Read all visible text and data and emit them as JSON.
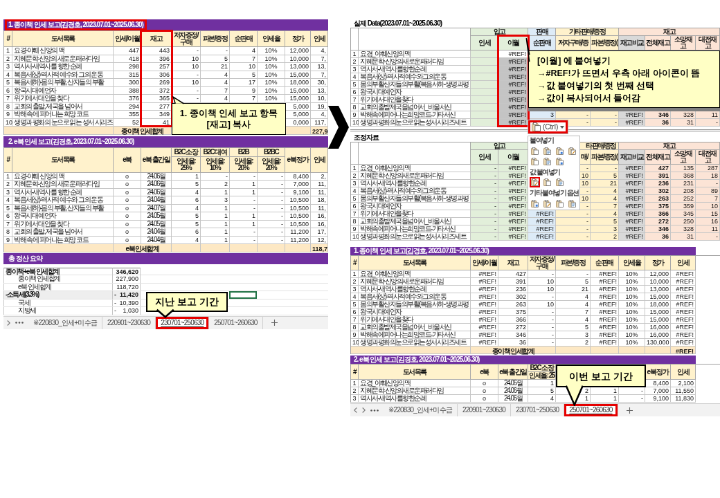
{
  "left_sheet": {
    "paper_report": {
      "title": "1. 종이책 인세 보고(김경호, 2023.07.01~2025.06.30)",
      "title_highlighted": true,
      "columns": {
        "no": {
          "label": "#",
          "highlighted": false
        },
        "title": {
          "label": "도서목록",
          "highlighted": false
        },
        "carryover": {
          "label": "인세/이월",
          "highlighted": false
        },
        "stock": {
          "label": "재고",
          "highlighted": true
        },
        "author_copies": {
          "label": "저자증정/구매",
          "highlighted": false
        },
        "damaged": {
          "label": "파본/증정",
          "highlighted": false
        },
        "net_sales": {
          "label": "순판매",
          "highlighted": false
        },
        "rate": {
          "label": "인세율",
          "highlighted": false
        },
        "price": {
          "label": "정가",
          "highlighted": false
        },
        "royalty": {
          "label": "인세",
          "highlighted": false
        }
      },
      "rows": [
        {
          "no": "1",
          "title": "요경-야훼 신앙의 맥",
          "carryover": "447",
          "stock": "443",
          "author_copies": "-",
          "damaged": "-",
          "net_sales": "4",
          "rate": "10%",
          "price": "12,000",
          "royalty": "4,"
        },
        {
          "no": "2",
          "title": "지혜문학-신앙의 새로운 패러다임",
          "carryover": "418",
          "stock": "396",
          "author_copies": "10",
          "damaged": "5",
          "net_sales": "7",
          "rate": "10%",
          "price": "10,000",
          "royalty": "7,"
        },
        {
          "no": "3",
          "title": "역사서-새역사를 향한 순례",
          "carryover": "298",
          "stock": "257",
          "author_copies": "10",
          "damaged": "21",
          "net_sales": "10",
          "rate": "10%",
          "price": "13,000",
          "royalty": "13,"
        },
        {
          "no": "4",
          "title": "복음서(상)-역사적 예수와 그의 운동",
          "carryover": "315",
          "stock": "306",
          "author_copies": "-",
          "damaged": "4",
          "net_sales": "5",
          "rate": "10%",
          "price": "15,000",
          "royalty": "7,"
        },
        {
          "no": "5",
          "title": "복음서(하)-몸의 부활, 산자들의 부활",
          "carryover": "300",
          "stock": "269",
          "author_copies": "10",
          "damaged": "4",
          "net_sales": "17",
          "rate": "10%",
          "price": "18,000",
          "royalty": "30,"
        },
        {
          "no": "6",
          "title": "왕국시대 예언자",
          "carryover": "388",
          "stock": "372",
          "author_copies": "-",
          "damaged": "7",
          "net_sales": "9",
          "rate": "10%",
          "price": "15,000",
          "royalty": "13,"
        },
        {
          "no": "7",
          "title": "위기에서 대안을 찾다",
          "carryover": "376",
          "stock": "365",
          "author_copies": "-",
          "damaged": "4",
          "net_sales": "7",
          "rate": "10%",
          "price": "15,000",
          "royalty": "10,"
        },
        {
          "no": "8",
          "title": "교회의 출발, 제국을 넘어서",
          "carryover": "294",
          "stock": "277",
          "price": "5,000",
          "royalty": "19,"
        },
        {
          "no": "9",
          "title": "박해 속에 피어나는 희망 코드",
          "carryover": "355",
          "stock": "349",
          "price": "5,000",
          "royalty": "4,"
        },
        {
          "no": "10",
          "title": "생명과 평화의 눈으로 읽는 성서 시리즈",
          "carryover": "52",
          "stock": "41",
          "price": "0,000",
          "royalty": "117,"
        }
      ],
      "total": {
        "label": "종이책 인세합계",
        "value": "227,9"
      },
      "callout": {
        "lines": [
          "1. 종이책 인세 보고 항목",
          "[재고] 복사"
        ]
      }
    },
    "ebook_report": {
      "title": "2. e북 인세 보고(김경호, 2023.07.01~2025.06.30)",
      "columns": {
        "no": {
          "label": "#"
        },
        "title": {
          "label": "도서목록"
        },
        "ebook": {
          "label": "e북"
        },
        "release": {
          "label": "e북 출간일"
        },
        "b2c_own": {
          "label": "B2C 소장",
          "sublabel": "인세율: 25%"
        },
        "b2c_rent": {
          "label": "B2C 대여",
          "sublabel": "인세율: 10%"
        },
        "b2b": {
          "label": "B2B",
          "sublabel": "인세율: 20%"
        },
        "b2bc": {
          "label": "B2BC",
          "sublabel": "인세율: 20%"
        },
        "ebook_price": {
          "label": "e북 정가"
        },
        "royalty": {
          "label": "인세"
        }
      },
      "rows": [
        {
          "no": "1",
          "title": "요경-야훼 신앙의 맥",
          "ebook": "o",
          "release": "24.06월",
          "b2c_own": "1",
          "b2c_rent": "-",
          "b2b": "-",
          "b2bc": "-",
          "ebook_price": "8,400",
          "royalty": "2,"
        },
        {
          "no": "2",
          "title": "지혜문학-신앙의 새로운 패러다임",
          "ebook": "o",
          "release": "24.06월",
          "b2c_own": "5",
          "b2c_rent": "2",
          "b2b": "1",
          "b2bc": "-",
          "ebook_price": "7,000",
          "royalty": "11,"
        },
        {
          "no": "3",
          "title": "역사서-새역사를 향한 순례",
          "ebook": "o",
          "release": "24.06월",
          "b2c_own": "4",
          "b2c_rent": "1",
          "b2b": "1",
          "b2bc": "-",
          "ebook_price": "9,100",
          "royalty": "11,"
        },
        {
          "no": "4",
          "title": "복음서(상)-역사적 예수와 그의 운동",
          "ebook": "o",
          "release": "24.04월",
          "b2c_own": "6",
          "b2c_rent": "3",
          "b2b": "-",
          "b2bc": "-",
          "ebook_price": "10,500",
          "royalty": "18,"
        },
        {
          "no": "5",
          "title": "복음서(하)-몸의 부활, 산자들의 부활",
          "ebook": "o",
          "release": "24.07월",
          "b2c_own": "4",
          "b2c_rent": "1",
          "b2b": "-",
          "b2bc": "-",
          "ebook_price": "10,500",
          "royalty": "11,"
        },
        {
          "no": "6",
          "title": "왕국시대 예언자",
          "ebook": "o",
          "release": "24.05월",
          "b2c_own": "5",
          "b2c_rent": "1",
          "b2b": "1",
          "b2bc": "-",
          "ebook_price": "10,500",
          "royalty": "16,"
        },
        {
          "no": "7",
          "title": "위기에서 대안을 찾다",
          "ebook": "o",
          "release": "24.05월",
          "b2c_own": "5",
          "b2c_rent": "1",
          "b2b": "1",
          "b2bc": "-",
          "ebook_price": "10,500",
          "royalty": "16,"
        },
        {
          "no": "8",
          "title": "교회의 출발, 제국을 넘어서",
          "ebook": "o",
          "release": "24.04월",
          "b2c_own": "6",
          "b2c_rent": "1",
          "b2b": "-",
          "b2bc": "-",
          "ebook_price": "11,200",
          "royalty": "17,"
        },
        {
          "no": "9",
          "title": "박해 속에 피어나는 희망 코드",
          "ebook": "o",
          "release": "24.04월",
          "b2c_own": "4",
          "b2c_rent": "1",
          "b2b": "-",
          "b2bc": "-",
          "ebook_price": "11,200",
          "royalty": "12,"
        }
      ],
      "total": {
        "label": "e북 인세합계",
        "value": "118,7"
      }
    },
    "summary": {
      "title": "총 정산 요약",
      "rows": [
        {
          "kind": "sum",
          "label": "종이책+e북 인세합계",
          "value": "346,620",
          "active_cell": false
        },
        {
          "kind": "item",
          "label": "종이책 인세합계",
          "value": "227,900",
          "active_cell": false
        },
        {
          "kind": "item",
          "label": "e북 인세합계",
          "value": "118,720",
          "active_cell": false
        },
        {
          "kind": "deduction",
          "label": "-소득세(3.3%)",
          "sign": "-",
          "value": "11,420",
          "active_cell": true
        },
        {
          "kind": "item",
          "label": "국세",
          "sign": "-",
          "value": "10,390",
          "active_cell": false
        },
        {
          "kind": "item",
          "label": "지방세",
          "sign": "-",
          "value": "1,030",
          "active_cell": false
        }
      ]
    },
    "sheet_tabs": [
      {
        "label": "※220830_인세+미수금",
        "selected": false,
        "highlighted": false
      },
      {
        "label": "220901~230630",
        "selected": false,
        "highlighted": false
      },
      {
        "label": "230701~250630",
        "selected": true,
        "highlighted": true
      },
      {
        "label": "250701~260630",
        "selected": false,
        "highlighted": false
      }
    ],
    "tab_callout": {
      "lines": [
        "지난 보고 기간"
      ]
    }
  },
  "right_sheet": {
    "actual_data": {
      "title": "실제 Data(2023.07.01~2025.06.30)",
      "groups": {
        "inbound": {
          "label": "입고",
          "color": "#e2efda"
        },
        "sales": {
          "label": "판매",
          "color": "#ddebf7"
        },
        "other": {
          "label": "기타판매/증정",
          "color": "#fff2cc"
        },
        "stock": {
          "label": "재고",
          "color": "#fce4d6"
        }
      },
      "columns": {
        "royalty": {
          "label": "인세",
          "color": "#e2efda",
          "highlighted": false,
          "selected": false
        },
        "carryover": {
          "label": "이월",
          "color": "#e2efda",
          "highlighted": true,
          "selected": true
        },
        "net_sales": {
          "label": "순판매",
          "color": "#ddebf7",
          "highlighted": false,
          "selected": false
        },
        "author": {
          "label": "저자구매/증",
          "color": "#fff2cc",
          "highlighted": false,
          "selected": false
        },
        "damaged": {
          "label": "파본/증정(",
          "color": "#fff2cc",
          "highlighted": false,
          "selected": false
        },
        "compare": {
          "label": "재고비교",
          "color": "#d9d9d9",
          "highlighted": false,
          "selected": false
        },
        "total_stock": {
          "label": "전체재고",
          "color": "#fce4d6",
          "highlighted": false,
          "selected": false
        },
        "somang": {
          "label": "소망재고",
          "color": "#fce4d6",
          "highlighted": false,
          "selected": false
        },
        "daejeon": {
          "label": "대전재고",
          "color": "#fce4d6",
          "highlighted": false,
          "selected": false
        }
      },
      "rows": [
        {
          "no": "1",
          "title": "요경_야훼신앙의맥",
          "carryover": "#REF!"
        },
        {
          "no": "2",
          "title": "지혜문학-신앙의새로운패러다임",
          "carryover": "#REF!"
        },
        {
          "no": "3",
          "title": "역사서-새역사를향한순례",
          "carryover": "#REF!"
        },
        {
          "no": "4",
          "title": "복음서(상)-역사적예수와그의운동",
          "carryover": "#REF!"
        },
        {
          "no": "5",
          "title": "몸의부활산자들의부활(복음서하-생명과평",
          "carryover": "#REF!"
        },
        {
          "no": "6",
          "title": "왕국시대예언자",
          "carryover": "#REF!"
        },
        {
          "no": "7",
          "title": "위기에서대안을찾다",
          "carryover": "#REF!"
        },
        {
          "no": "8",
          "title": "교회의출발제국을넘어서_바울서신",
          "carryover": "#REF!"
        },
        {
          "no": "9",
          "title": "박해속에피어나는희망코드-기타서신",
          "carryover": "#REF!",
          "net_sales": "3",
          "author": "-",
          "damaged": "-",
          "compare": "#REF!",
          "total_stock": "346",
          "somang": "328",
          "daejeon": "11"
        },
        {
          "no": "10",
          "title": "생명과평화의눈으로읽는성서시리즈세트",
          "carryover": "#REF!",
          "author": "-",
          "damaged": "-",
          "compare": "#REF!",
          "total_stock": "36",
          "somang": "31",
          "daejeon": "-"
        }
      ],
      "callout": {
        "lines": [
          "[이월] 에 붙여넣기",
          "→#REF!가 뜨면서 우측 아래 아이콘이 뜸",
          "→값 붙여넣기의 첫 번째 선택",
          "→값이 복사되어서 들어감"
        ]
      }
    },
    "paste_button": {
      "label": "(Ctrl)",
      "highlighted": true
    },
    "paste_menu": {
      "sections": [
        {
          "title": "붙여넣기",
          "options": [
            {
              "highlighted": false
            },
            {
              "highlighted": false
            },
            {
              "highlighted": false
            },
            {
              "highlighted": false
            },
            {
              "highlighted": false
            },
            {
              "highlighted": false
            },
            {
              "highlighted": false
            }
          ]
        },
        {
          "title": "값 붙여넣기",
          "options": [
            {
              "highlighted": true
            },
            {
              "highlighted": false
            },
            {
              "highlighted": false
            }
          ]
        },
        {
          "title": "기타 붙여넣기 옵션",
          "options": [
            {
              "highlighted": false
            },
            {
              "highlighted": false
            },
            {
              "highlighted": false
            },
            {
              "highlighted": false
            }
          ]
        }
      ]
    },
    "adjustment": {
      "title": "조정자료",
      "groups": {
        "inbound": {
          "label": "입고",
          "color": "#e2efda"
        },
        "other": {
          "label": "타판매/증정",
          "color": "#fff2cc"
        },
        "stock": {
          "label": "재고",
          "color": "#fce4d6"
        }
      },
      "columns": {
        "royalty": {
          "label": "인세",
          "color": "#e2efda"
        },
        "carryover": {
          "label": "이월",
          "color": "#e2efda"
        },
        "net_sales": {
          "color": "#ddebf7"
        },
        "author": {
          "label": "매/",
          "color": "#fff2cc"
        },
        "damaged": {
          "label": "파본/증정(",
          "color": "#fff2cc"
        },
        "compare": {
          "label": "재고비교",
          "color": "#d9d9d9"
        },
        "total_stock": {
          "label": "전체재고",
          "color": "#fce4d6"
        },
        "somang": {
          "label": "소망재고",
          "color": "#fce4d6"
        },
        "daejeon": {
          "label": "대전재고",
          "color": "#fce4d6"
        }
      },
      "rows": [
        {
          "no": "1",
          "title": "요경_야훼신앙의맥",
          "royalty": "-",
          "carryover": "#REF!",
          "author": "-",
          "damaged": "-",
          "compare": "#REF!",
          "total_stock": "427",
          "somang": "135",
          "daejeon": "287"
        },
        {
          "no": "2",
          "title": "지혜문학-신앙의새로운패러다임",
          "royalty": "-",
          "carryover": "#REF!",
          "author": "10",
          "damaged": "5",
          "compare": "#REF!",
          "total_stock": "391",
          "somang": "368",
          "daejeon": "18"
        },
        {
          "no": "3",
          "title": "역사서-새역사를향한순례",
          "royalty": "-",
          "carryover": "#REF!",
          "author": "10",
          "damaged": "21",
          "compare": "#REF!",
          "total_stock": "236",
          "somang": "231",
          "daejeon": "-"
        },
        {
          "no": "4",
          "title": "복음서(상)-역사적예수와그의운동",
          "royalty": "-",
          "carryover": "#REF!",
          "author": "-",
          "damaged": "4",
          "compare": "#REF!",
          "total_stock": "302",
          "somang": "208",
          "daejeon": "89"
        },
        {
          "no": "5",
          "title": "몸의부활산자들의부활(복음서하-생명과평",
          "royalty": "-",
          "carryover": "#REF!",
          "author": "10",
          "damaged": "4",
          "compare": "#REF!",
          "total_stock": "263",
          "somang": "252",
          "daejeon": "7"
        },
        {
          "no": "6",
          "title": "왕국시대예언자",
          "royalty": "-",
          "carryover": "#REF!",
          "author": "-",
          "damaged": "7",
          "compare": "#REF!",
          "total_stock": "375",
          "somang": "359",
          "daejeon": "10"
        },
        {
          "no": "7",
          "title": "위기에서대안을찾다",
          "royalty": "-",
          "carryover": "#REF!",
          "net_sales": "#REF!",
          "author": "-",
          "damaged": "4",
          "compare": "#REF!",
          "total_stock": "366",
          "somang": "345",
          "daejeon": "15"
        },
        {
          "no": "8",
          "title": "교회의출발제국을넘어서_바울서신",
          "royalty": "-",
          "carryover": "#REF!",
          "net_sales": "#REF!",
          "author": "-",
          "damaged": "5",
          "compare": "#REF!",
          "total_stock": "272",
          "somang": "250",
          "daejeon": "16"
        },
        {
          "no": "9",
          "title": "박해속에피어나는희망코드-기타서신",
          "royalty": "-",
          "carryover": "#REF!",
          "net_sales": "#REF!",
          "author": "-",
          "damaged": "3",
          "compare": "#REF!",
          "total_stock": "346",
          "somang": "328",
          "daejeon": "11"
        },
        {
          "no": "10",
          "title": "생명과평화의눈으로읽는성서시리즈세트",
          "royalty": "-",
          "carryover": "#REF!",
          "net_sales": "#REF!",
          "author": "-",
          "damaged": "2",
          "compare": "#REF!",
          "total_stock": "36",
          "somang": "31",
          "daejeon": "-"
        }
      ]
    },
    "paper_report": {
      "title": "1. 종이책 인세 보고(김경호, 2023.07.01~2025.06.30)",
      "columns": {
        "no": {
          "label": "#"
        },
        "title": {
          "label": "도서목록"
        },
        "carryover": {
          "label": "인세/이월"
        },
        "stock": {
          "label": "재고"
        },
        "author_copies": {
          "label": "저자증정/구매"
        },
        "damaged": {
          "label": "파본/증정"
        },
        "net_sales": {
          "label": "순판매"
        },
        "rate": {
          "label": "인세율"
        },
        "price": {
          "label": "정가"
        },
        "royalty": {
          "label": "인세"
        }
      },
      "rows": [
        {
          "no": "1",
          "title": "요경_야훼신앙의맥",
          "carryover": "#REF!",
          "stock": "427",
          "author_copies": "-",
          "damaged": "-",
          "net_sales": "#REF!",
          "rate": "10%",
          "price": "12,000",
          "royalty": "#REF!"
        },
        {
          "no": "2",
          "title": "지혜문학-신앙의새로운패러다임",
          "carryover": "#REF!",
          "stock": "391",
          "author_copies": "10",
          "damaged": "5",
          "net_sales": "#REF!",
          "rate": "10%",
          "price": "10,000",
          "royalty": "#REF!"
        },
        {
          "no": "3",
          "title": "역사서-새역사를향한순례",
          "carryover": "#REF!",
          "stock": "236",
          "author_copies": "10",
          "damaged": "21",
          "net_sales": "#REF!",
          "rate": "10%",
          "price": "13,000",
          "royalty": "#REF!"
        },
        {
          "no": "4",
          "title": "복음서(상)-역사적예수와그의운동",
          "carryover": "#REF!",
          "stock": "302",
          "author_copies": "-",
          "damaged": "4",
          "net_sales": "#REF!",
          "rate": "10%",
          "price": "15,000",
          "royalty": "#REF!"
        },
        {
          "no": "5",
          "title": "몸의부활산자들의부활(복음서하-생명과평",
          "carryover": "#REF!",
          "stock": "263",
          "author_copies": "10",
          "damaged": "4",
          "net_sales": "#REF!",
          "rate": "10%",
          "price": "18,000",
          "royalty": "#REF!"
        },
        {
          "no": "6",
          "title": "왕국시대예언자",
          "carryover": "#REF!",
          "stock": "375",
          "author_copies": "-",
          "damaged": "7",
          "net_sales": "#REF!",
          "rate": "10%",
          "price": "15,000",
          "royalty": "#REF!"
        },
        {
          "no": "7",
          "title": "위기에서대안을찾다",
          "carryover": "#REF!",
          "stock": "366",
          "author_copies": "-",
          "damaged": "4",
          "net_sales": "#REF!",
          "rate": "10%",
          "price": "15,000",
          "royalty": "#REF!"
        },
        {
          "no": "8",
          "title": "교회의출발제국을넘어서_바울서신",
          "carryover": "#REF!",
          "stock": "272",
          "author_copies": "-",
          "damaged": "5",
          "net_sales": "#REF!",
          "rate": "10%",
          "price": "16,000",
          "royalty": "#REF!"
        },
        {
          "no": "9",
          "title": "박해속에피어나는희망코드-기타서신",
          "carryover": "#REF!",
          "stock": "346",
          "author_copies": "-",
          "damaged": "3",
          "net_sales": "#REF!",
          "rate": "10%",
          "price": "16,000",
          "royalty": "#REF!"
        },
        {
          "no": "10",
          "title": "생명과평화의눈으로읽는성서시리즈세트",
          "carryover": "#REF!",
          "stock": "36",
          "author_copies": "-",
          "damaged": "2",
          "net_sales": "#REF!",
          "rate": "10%",
          "price": "130,000",
          "royalty": "#REF!"
        }
      ],
      "total": {
        "label": "종이책 인세합계",
        "value": "#REF!"
      }
    },
    "ebook_report": {
      "title": "2. e북 인세 보고(김경호, 2023.07.01~2025.06.30)",
      "columns": {
        "no": {
          "label": "#"
        },
        "title": {
          "label": "도서목록"
        },
        "ebook": {
          "label": "e북"
        },
        "release": {
          "label": "e북 출간일"
        },
        "b2c_own": {
          "label": "B2C 소장",
          "sublabel": "인세율: 25"
        },
        "ebook_price": {
          "label": "e북 정가"
        },
        "royalty": {
          "label": "인세"
        }
      },
      "rows": [
        {
          "no": "1",
          "title": "요경_야훼신앙의맥",
          "ebook": "o",
          "release": "24.06월",
          "b2c_own": "1",
          "ebook_price": "8,400",
          "royalty": "2,100"
        },
        {
          "no": "2",
          "title": "지혜문학-신앙의새로운패러다임",
          "ebook": "o",
          "release": "24.06월",
          "b2c_own": "5",
          "b2c_rent": "2",
          "b2b": "1",
          "b2bc": "-",
          "ebook_price": "7,000",
          "royalty": "11,550"
        },
        {
          "no": "3",
          "title": "역사서-새역사를향한순례",
          "ebook": "o",
          "release": "24.06월",
          "b2c_own": "4",
          "b2c_rent": "1",
          "b2b": "1",
          "b2bc": "-",
          "ebook_price": "9,100",
          "royalty": "11,830"
        }
      ]
    },
    "sheet_tabs": [
      {
        "label": "※220830_인세+미수금",
        "selected": false,
        "highlighted": false
      },
      {
        "label": "220901~230630",
        "selected": false,
        "highlighted": false
      },
      {
        "label": "230701~250630",
        "selected": false,
        "highlighted": false
      },
      {
        "label": "250701~260630",
        "selected": true,
        "highlighted": true
      }
    ],
    "tab_callout": {
      "lines": [
        "이번 보고 기간"
      ]
    }
  }
}
